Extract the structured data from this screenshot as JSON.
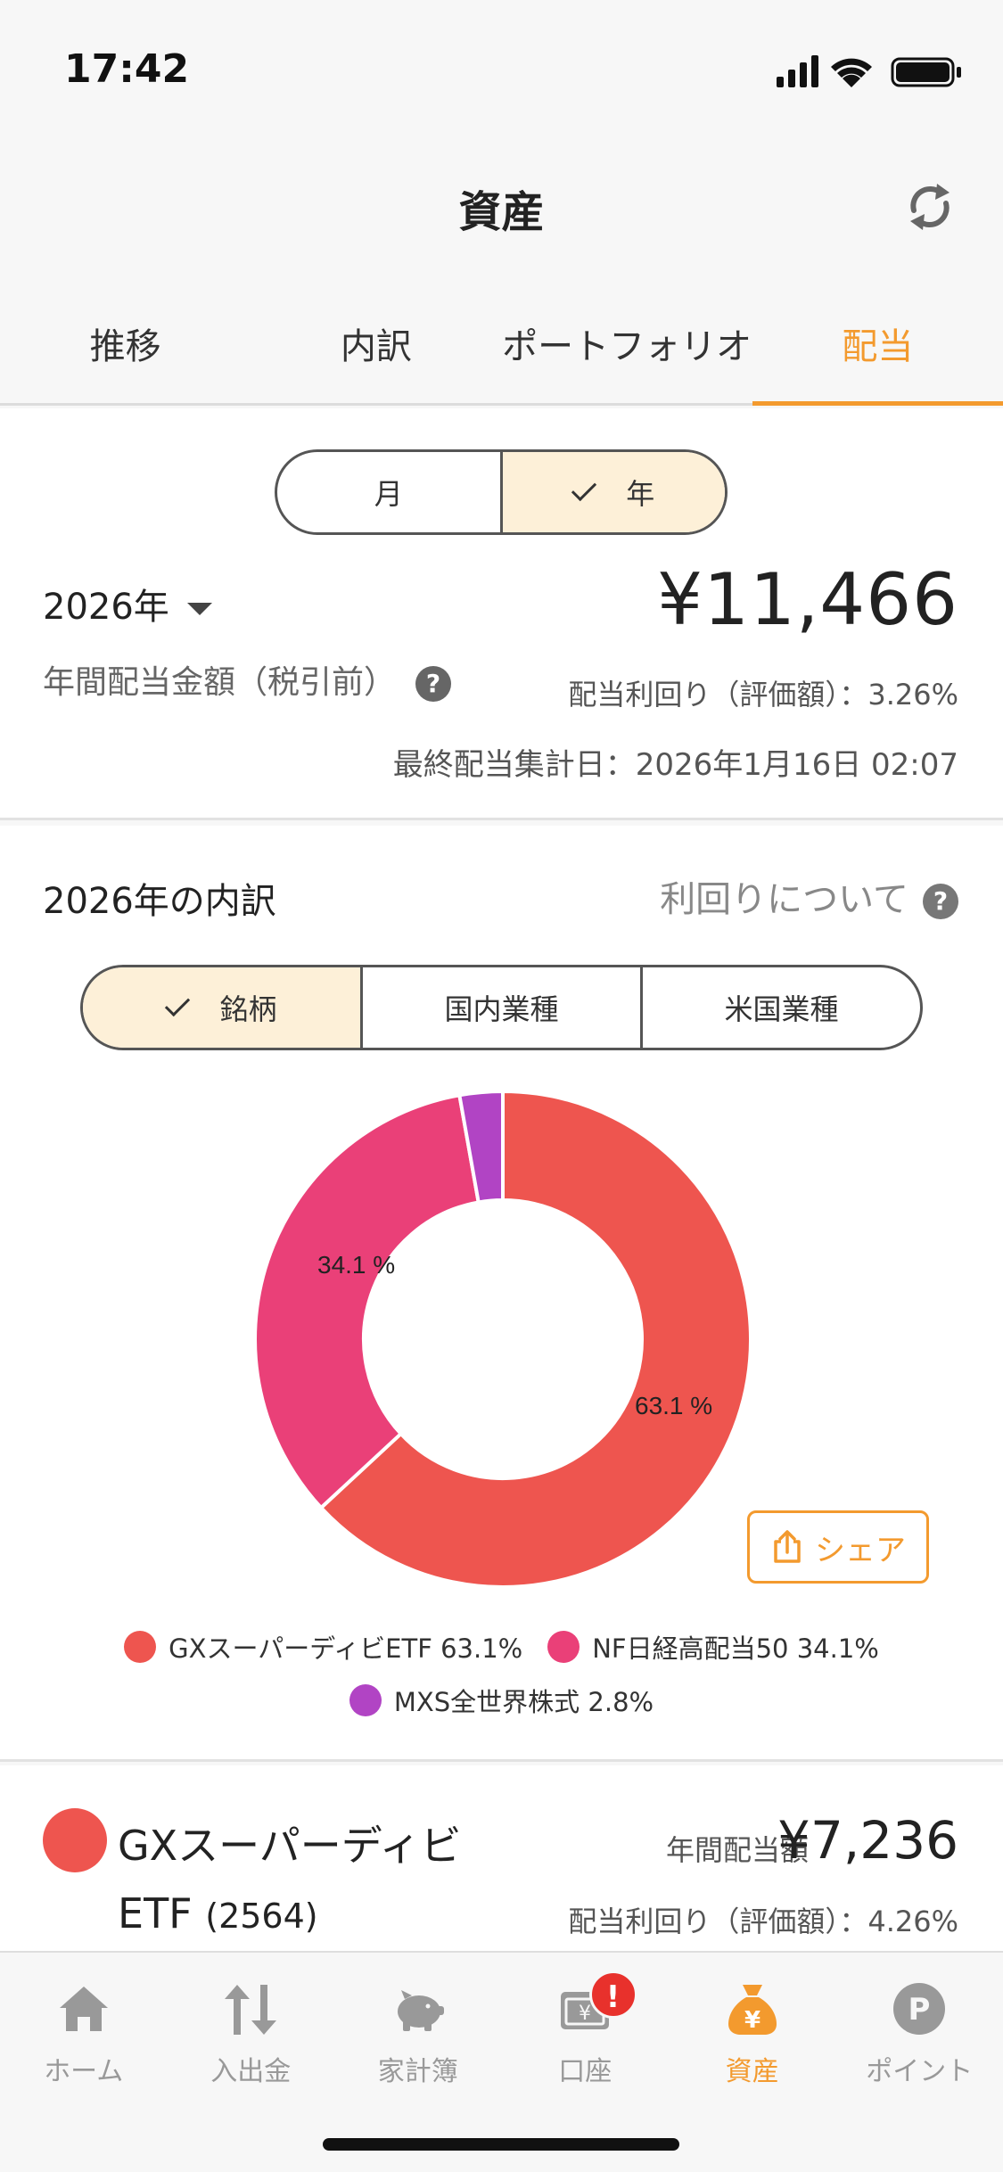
{
  "status_bar": {
    "time": "17:42"
  },
  "header": {
    "title": "資産"
  },
  "tabs": [
    {
      "label": "推移",
      "active": false
    },
    {
      "label": "内訳",
      "active": false
    },
    {
      "label": "ポートフォリオ",
      "active": false
    },
    {
      "label": "配当",
      "active": true
    }
  ],
  "summary": {
    "period_options": [
      "月",
      "年"
    ],
    "selected_period": "年",
    "year": "2026年",
    "annual_label": "年間配当金額（税引前）",
    "annual_amount": "¥11,466",
    "yield_text": "配当利回り（評価額）：3.26%",
    "updated_text": "最終配当集計日：2026年1月16日 02:07"
  },
  "breakdown": {
    "title": "2026年の内訳",
    "yield_info": "利回りについて",
    "category_options": [
      "銘柄",
      "国内業種",
      "米国業種"
    ],
    "selected_category": "銘柄",
    "share_label": "シェア",
    "label_left": "34.1 %",
    "label_right": "63.1 %"
  },
  "chart_data": {
    "type": "pie",
    "categories": [
      "GXスーパーディビETF",
      "NF日経高配当50",
      "MXS全世界株式"
    ],
    "values": [
      63.1,
      34.1,
      2.8
    ],
    "colors": [
      "#ee554f",
      "#ea4078",
      "#b144c4"
    ],
    "legend": [
      "GXスーパーディビETF 63.1%",
      "NF日経高配当50 34.1%",
      "MXS全世界株式 2.8%"
    ],
    "legend_placement": "bottom"
  },
  "holding": {
    "name": "GXスーパーディビETF",
    "name_line1": "GXスーパーディビ",
    "name_line2": "ETF",
    "code": "(2564)",
    "amount_label": "年間配当額",
    "amount": "¥7,236",
    "yield_text": "配当利回り（評価額）：4.26%",
    "color": "#ee554f"
  },
  "bottom_nav": {
    "items": [
      {
        "label": "ホーム",
        "icon": "home-icon",
        "active": false
      },
      {
        "label": "入出金",
        "icon": "transfer-icon",
        "active": false
      },
      {
        "label": "家計簿",
        "icon": "piggy-bank-icon",
        "active": false
      },
      {
        "label": "口座",
        "icon": "account-card-icon",
        "active": false,
        "badge": "!"
      },
      {
        "label": "資産",
        "icon": "yen-bag-icon",
        "active": true
      },
      {
        "label": "ポイント",
        "icon": "point-icon",
        "active": false
      }
    ]
  },
  "colors": {
    "accent": "#f39a2e",
    "selected_bg": "#fdf0d8",
    "badge": "#e8312c"
  }
}
